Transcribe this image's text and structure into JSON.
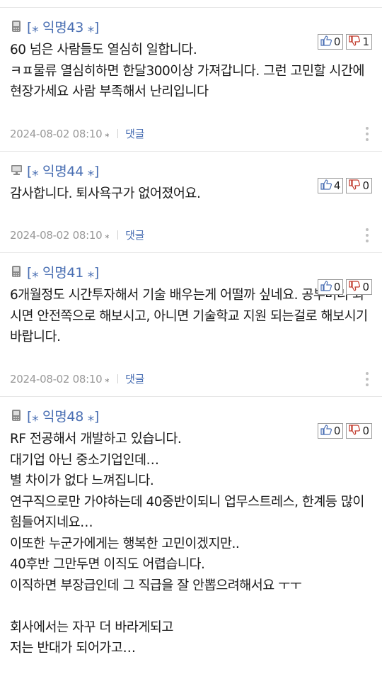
{
  "comments": [
    {
      "device": "phone-icon",
      "author": "[⁎ 익명43 ⁎]",
      "likes": "0",
      "dislikes": "1",
      "text": "60 넘은 사람들도 열심히 일합니다.\nㅋㅍ물류 열심히하면 한달300이상 가져갑니다. 그런 고민할 시간에 현장가세요 사람 부족해서 난리입니다",
      "date": "2024-08-02 08:10",
      "reply_label": "댓글"
    },
    {
      "device": "desktop-icon",
      "author": "[⁎ 익명44 ⁎]",
      "likes": "4",
      "dislikes": "0",
      "text": "감사합니다. 퇴사욕구가 없어졌어요.",
      "date": "2024-08-02 08:10",
      "reply_label": "댓글"
    },
    {
      "device": "phone-icon",
      "author": "[⁎ 익명41 ⁎]",
      "likes": "0",
      "dislikes": "0",
      "text": "6개월정도 시간투자해서 기술 배우는게 어떨까 싶네요. 공부머리 되시면 안전쪽으로 해보시고, 아니면 기술학교 지원 되는걸로 해보시기 바랍니다.",
      "date": "2024-08-02 08:10",
      "reply_label": "댓글"
    },
    {
      "device": "phone-icon",
      "author": "[⁎ 익명48 ⁎]",
      "likes": "0",
      "dislikes": "0",
      "text": "RF 전공해서 개발하고 있습니다.\n대기업 아닌 중소기업인데…\n별 차이가 없다 느껴집니다.\n연구직으로만 가야하는데 40중반이되니 업무스트레스, 한계등 많이 힘들어지네요…\n이또한 누군가에게는 행복한 고민이겠지만..\n40후반 그만두면 이직도 어렵습니다.\n이직하면 부장급인데 그 직급을 잘 안뽑으려해서요 ㅜㅜ\n\n회사에서는 자꾸 더 바라게되고\n저는 반대가 되어가고…"
    }
  ],
  "marker": "⁎",
  "colors": {
    "author": "#4a6fb3",
    "border": "#e6e6e6",
    "meta": "#999999"
  }
}
